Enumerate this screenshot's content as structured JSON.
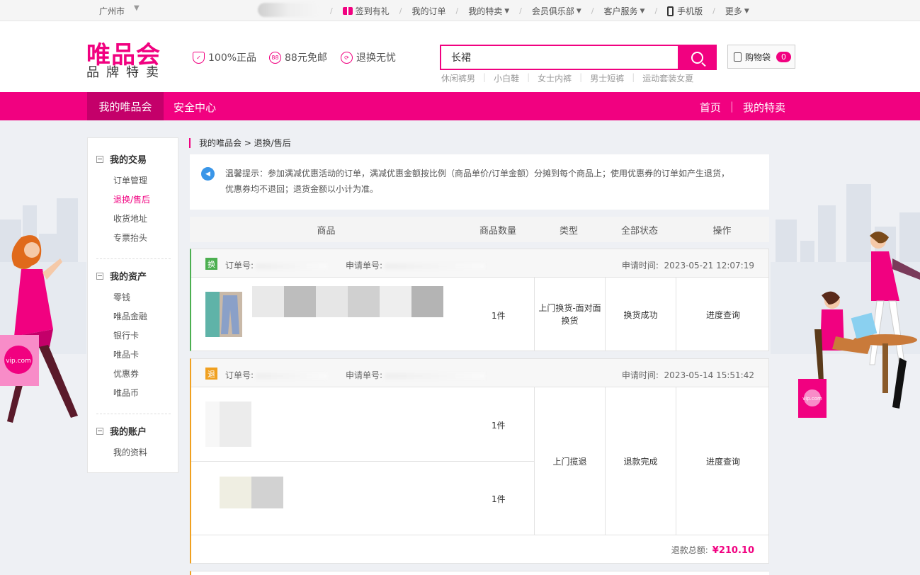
{
  "topbar": {
    "city": "广州市",
    "nav": [
      {
        "label": "签到有礼",
        "icon": "gift-icon",
        "caret": false
      },
      {
        "label": "我的订单",
        "caret": false
      },
      {
        "label": "我的特卖",
        "caret": true
      },
      {
        "label": "会员俱乐部",
        "caret": true
      },
      {
        "label": "客户服务",
        "caret": true
      },
      {
        "label": "手机版",
        "icon": "mobile-icon",
        "caret": false
      },
      {
        "label": "更多",
        "caret": true
      }
    ]
  },
  "header": {
    "logo_main": "唯品会",
    "logo_sub": "品牌特卖",
    "promises": [
      "100%正品",
      "88元免邮",
      "退换无忧"
    ],
    "promise_icons": [
      "shield-icon",
      "88-badge-icon",
      "exchange-icon"
    ],
    "search_value": "长裙",
    "hotwords": [
      "休闲裤男",
      "小白鞋",
      "女士内裤",
      "男士短裤",
      "运动套装女夏"
    ],
    "cart_label": "购物袋",
    "cart_count": "0"
  },
  "pinknav": {
    "active": "我的唯品会",
    "tab2": "安全中心",
    "right": [
      "首页",
      "我的特卖"
    ]
  },
  "sidebar": {
    "groups": [
      {
        "title": "我的交易",
        "items": [
          "订单管理",
          "退换/售后",
          "收货地址",
          "专票抬头"
        ]
      },
      {
        "title": "我的资产",
        "items": [
          "零钱",
          "唯品金融",
          "银行卡",
          "唯品卡",
          "优惠券",
          "唯品币"
        ]
      },
      {
        "title": "我的账户",
        "items": [
          "我的资料"
        ]
      }
    ],
    "active_item": "退换/售后"
  },
  "breadcrumb": "我的唯品会 > 退换/售后",
  "notice": {
    "line1": "温馨提示：参加满减优惠活动的订单，满减优惠金额按比例（商品单价/订单金额）分摊到每个商品上；使用优惠券的订单如产生退货，",
    "line2": "优惠券均不退回；退货金额以小计为准。"
  },
  "table_headers": [
    "商品",
    "商品数量",
    "类型",
    "全部状态",
    "操作"
  ],
  "orders": [
    {
      "tag": "换",
      "tag_color": "#4caf50",
      "order_no_label": "订单号:",
      "apply_no_label": "申请单号:",
      "time_label": "申请时间:",
      "time": "2023-05-21 12:07:19",
      "qty": "1件",
      "type": "上门换货-面对面换货",
      "status": "换货成功",
      "action": "进度查询"
    },
    {
      "tag": "退",
      "tag_color": "#f0a020",
      "order_no_label": "订单号:",
      "apply_no_label": "申请单号:",
      "time_label": "申请时间:",
      "time": "2023-05-14 15:51:42",
      "qty1": "1件",
      "qty2": "1件",
      "type": "上门揽退",
      "status": "退款完成",
      "action": "进度查询",
      "total_label": "退款总额:",
      "total": "¥210.10"
    }
  ],
  "bag_label": "vip.com",
  "colors": {
    "brand": "#f10180",
    "brand_dark": "#c4006a"
  }
}
